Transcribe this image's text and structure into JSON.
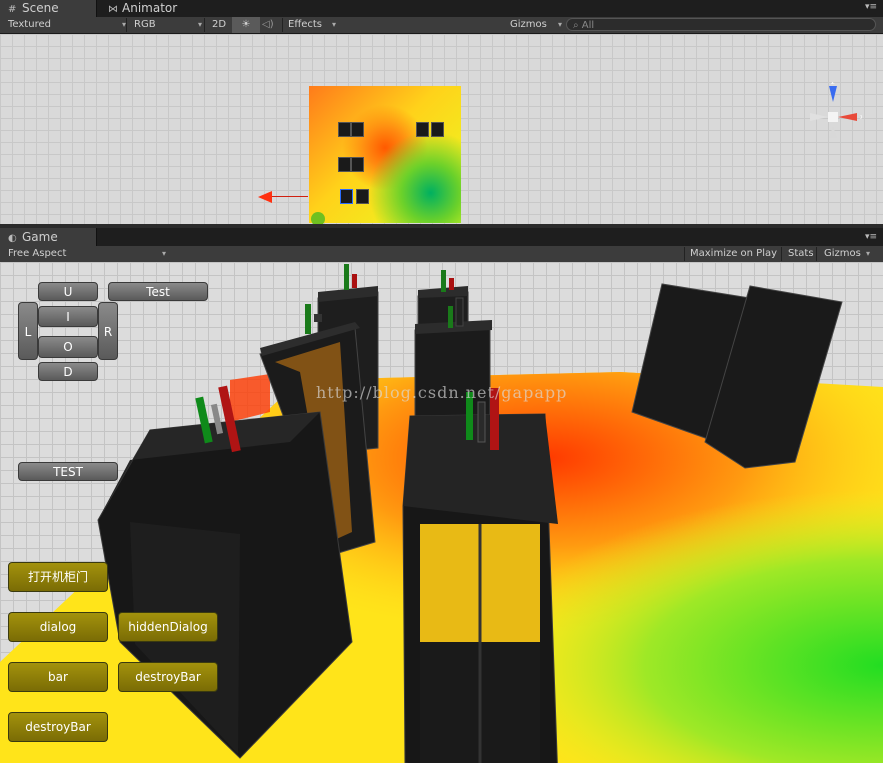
{
  "scene_tabs": {
    "scene": "Scene",
    "animator": "Animator"
  },
  "scene_toolbar": {
    "shading": "Textured",
    "render_mode": "RGB",
    "mode_2d": "2D",
    "effects": "Effects",
    "gizmos": "Gizmos",
    "search_placeholder": "All"
  },
  "gizmo_axes": {
    "y": "y",
    "z": "z",
    "x": "x"
  },
  "game_tab": {
    "label": "Game"
  },
  "game_toolbar": {
    "aspect": "Free Aspect",
    "maximize": "Maximize on Play",
    "stats": "Stats",
    "gizmos": "Gizmos"
  },
  "controls": {
    "up": "U",
    "in": "I",
    "out": "O",
    "down": "D",
    "left": "L",
    "right": "R",
    "test_small": "Test",
    "test_big": "TEST"
  },
  "actions": {
    "open_door": "打开机柜门",
    "dialog": "dialog",
    "hidden_dialog": "hiddenDialog",
    "bar": "bar",
    "destroy_bar_1": "destroyBar",
    "destroy_bar_2": "destroyBar"
  },
  "watermark": "http://blog.csdn.net/gapapp",
  "colors": {
    "gui_button": "#6e6e6e",
    "gui_action": "#8f800a",
    "heat_hot": "#ff3a00",
    "heat_mid": "#ffd21a",
    "heat_cool": "#22dd22"
  }
}
